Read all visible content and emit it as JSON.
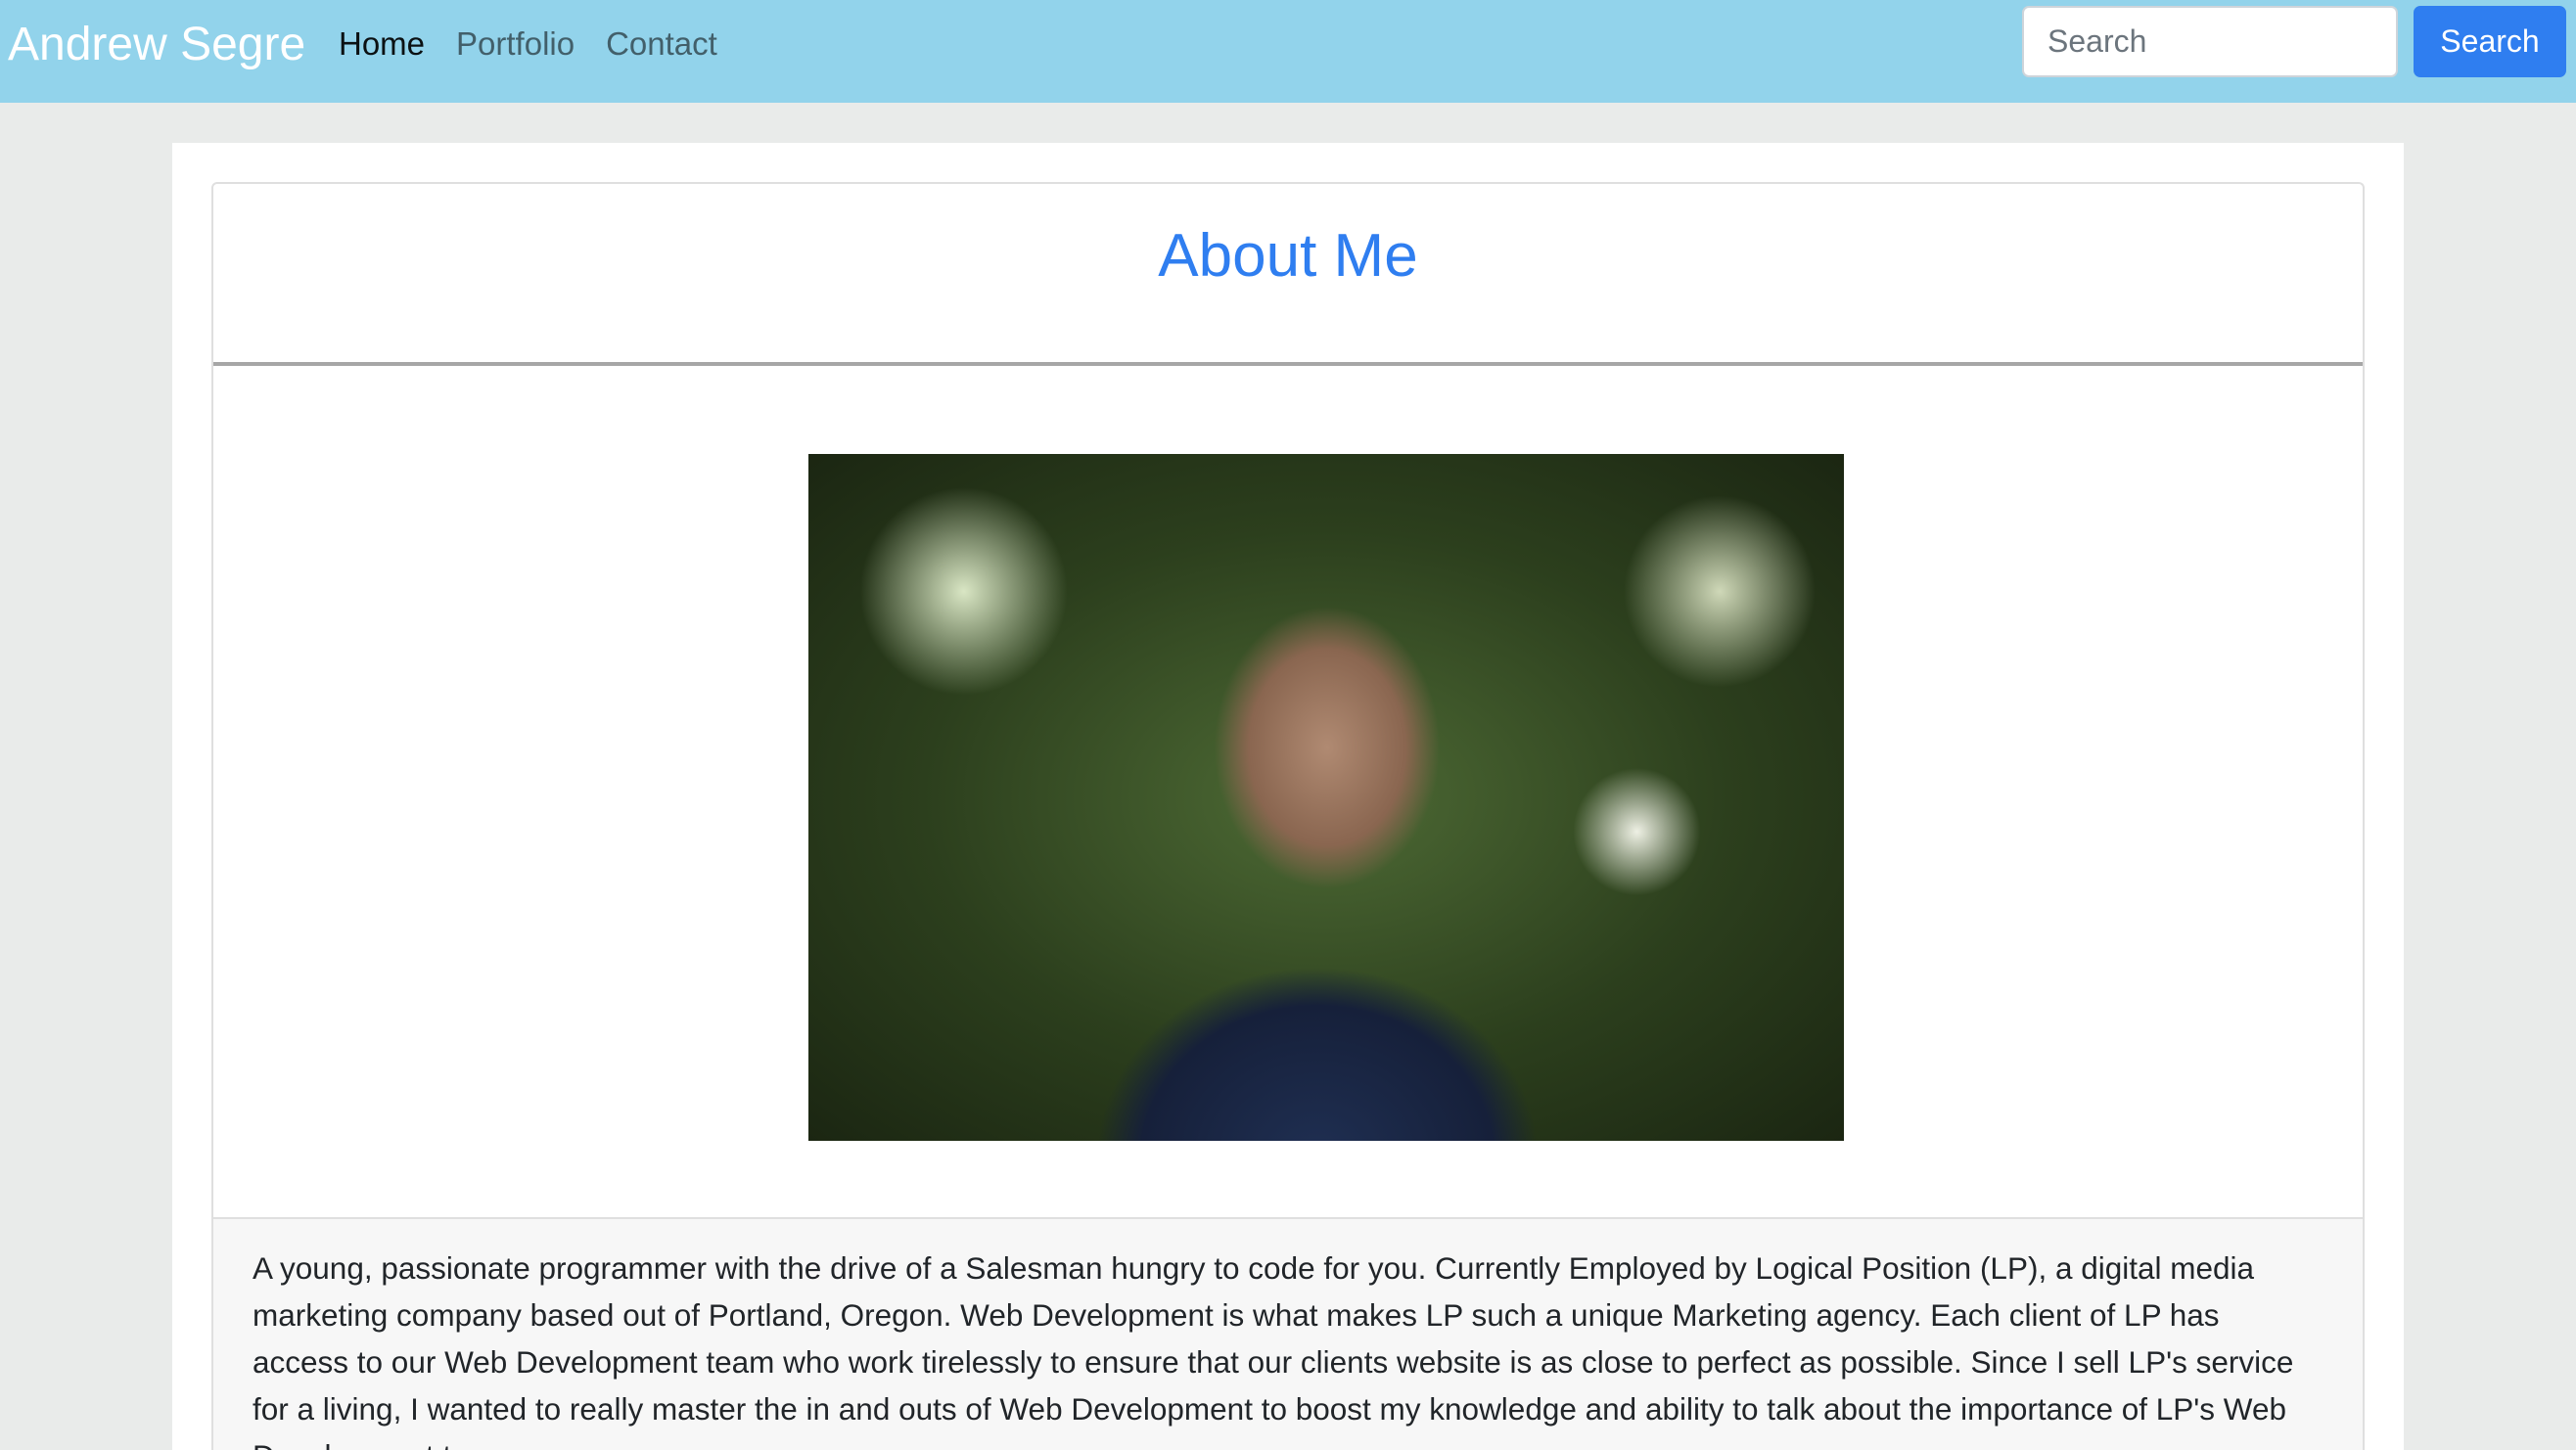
{
  "navbar": {
    "brand": "Andrew Segre",
    "links": [
      {
        "label": "Home",
        "active": true
      },
      {
        "label": "Portfolio",
        "active": false
      },
      {
        "label": "Contact",
        "active": false
      }
    ],
    "search": {
      "placeholder": "Search",
      "value": "",
      "button_label": "Search"
    }
  },
  "colors": {
    "navbar_background": "#92d3eb",
    "accent": "#2f7ef0",
    "page_background": "#e9ebea"
  },
  "main": {
    "title": "About Me",
    "photo": {
      "alt": "Portrait of Andrew Segre"
    },
    "description": "A young, passionate programmer with the drive of a Salesman hungry to code for you. Currently Employed by Logical Position (LP), a digital media marketing company based out of Portland, Oregon. Web Development is what makes LP such a unique Marketing agency. Each client of LP has access to our Web Development team who work tirelessly to ensure that our clients website is as close to perfect as possible. Since I sell LP's service for a living, I wanted to really master the in and outs of Web Development to boost my knowledge and ability to talk about the importance of LP's Web Development team."
  }
}
